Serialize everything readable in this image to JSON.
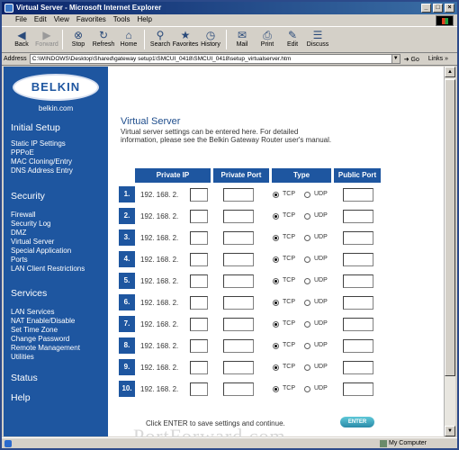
{
  "window": {
    "title": "Virtual Server - Microsoft Internet Explorer",
    "minimize": "_",
    "maximize": "□",
    "close": "×"
  },
  "menu": [
    "File",
    "Edit",
    "View",
    "Favorites",
    "Tools",
    "Help"
  ],
  "toolbar": [
    {
      "label": "Back",
      "icon": "back-arrow-icon",
      "glyph": "◀",
      "disabled": false
    },
    {
      "label": "Forward",
      "icon": "forward-arrow-icon",
      "glyph": "▶",
      "disabled": true
    },
    {
      "label": "Stop",
      "icon": "stop-icon",
      "glyph": "⊗",
      "disabled": false
    },
    {
      "label": "Refresh",
      "icon": "refresh-icon",
      "glyph": "↻",
      "disabled": false
    },
    {
      "label": "Home",
      "icon": "home-icon",
      "glyph": "⌂",
      "disabled": false
    },
    {
      "label": "Search",
      "icon": "search-icon",
      "glyph": "⚲",
      "disabled": false
    },
    {
      "label": "Favorites",
      "icon": "favorites-icon",
      "glyph": "★",
      "disabled": false
    },
    {
      "label": "History",
      "icon": "history-icon",
      "glyph": "◷",
      "disabled": false
    },
    {
      "label": "Mail",
      "icon": "mail-icon",
      "glyph": "✉",
      "disabled": false
    },
    {
      "label": "Print",
      "icon": "print-icon",
      "glyph": "⎙",
      "disabled": false
    },
    {
      "label": "Edit",
      "icon": "edit-icon",
      "glyph": "✎",
      "disabled": false
    },
    {
      "label": "Discuss",
      "icon": "discuss-icon",
      "glyph": "☰",
      "disabled": false
    }
  ],
  "address": {
    "label": "Address",
    "url": "C:\\WINDOWS\\Desktop\\Shared\\gateway setup1\\SMCUI_0418\\SMCUI_0418\\setup_virtualserver.htm",
    "go": "Go",
    "links": "Links »"
  },
  "sidebar": {
    "logo": "BELKIN",
    "logo_sub": "belkin.com",
    "sections": [
      {
        "title": "Initial Setup",
        "items": [
          "Static IP Settings",
          "PPPoE",
          "MAC Cloning/Entry",
          "DNS Address Entry"
        ]
      },
      {
        "title": "Security",
        "items": [
          "Firewall",
          "Security Log",
          "DMZ",
          "Virtual Server",
          "Special Application",
          "Ports",
          "LAN Client Restrictions"
        ]
      },
      {
        "title": "Services",
        "items": [
          "LAN Services",
          "NAT Enable/Disable",
          "Set Time Zone",
          "Change Password",
          "Remote Management",
          "Utilities"
        ]
      },
      {
        "title": "Status",
        "items": []
      },
      {
        "title": "Help",
        "items": []
      }
    ]
  },
  "main": {
    "title": "Virtual Server",
    "description": "Virtual server settings can be entered here. For detailed information, please see the Belkin Gateway Router user's manual.",
    "columns": [
      "Private IP",
      "Private Port",
      "Type",
      "Public Port"
    ],
    "ip_prefix": "192. 168. 2.",
    "tcp_label": "TCP",
    "udp_label": "UDP",
    "rows": [
      "1.",
      "2.",
      "3.",
      "4.",
      "5.",
      "6.",
      "7.",
      "8.",
      "9.",
      "10."
    ],
    "footer": "Click ENTER to save settings and continue.",
    "enter_button": "ENTER",
    "watermark": "PortForward.com"
  },
  "status": {
    "left": "",
    "right": "My Computer"
  }
}
